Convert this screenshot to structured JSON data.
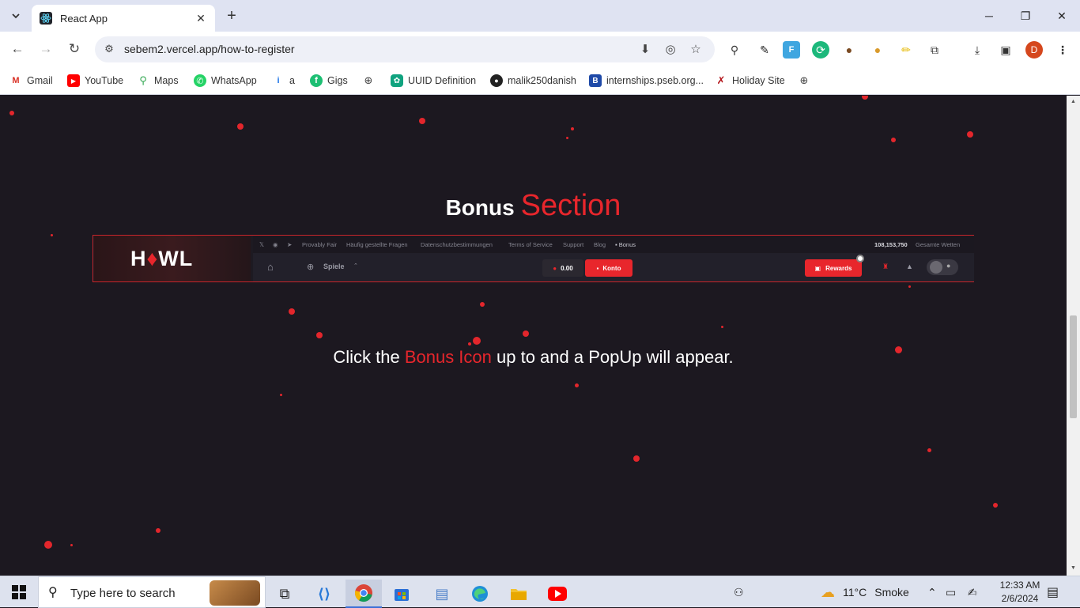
{
  "browser": {
    "tab_title": "React App",
    "url": "sebem2.vercel.app/how-to-register",
    "avatar_letter": "D",
    "bookmarks": [
      {
        "label": "Gmail",
        "icon": "gmail-icon"
      },
      {
        "label": "YouTube",
        "icon": "youtube-icon"
      },
      {
        "label": "Maps",
        "icon": "maps-icon"
      },
      {
        "label": "WhatsApp",
        "icon": "whatsapp-icon"
      },
      {
        "label": "a",
        "icon": "info-icon"
      },
      {
        "label": "Gigs",
        "icon": "fiverr-icon"
      },
      {
        "label": "",
        "icon": "globe-icon"
      },
      {
        "label": "UUID Definition",
        "icon": "openai-icon"
      },
      {
        "label": "malik250danish",
        "icon": "github-icon"
      },
      {
        "label": "internships.pseb.org...",
        "icon": "pseb-icon"
      },
      {
        "label": "Holiday Site",
        "icon": "holiday-icon"
      },
      {
        "label": "",
        "icon": "globe-icon"
      }
    ]
  },
  "page": {
    "heading_word1": "Bonus",
    "heading_word2": "Section",
    "banner": {
      "logo_left": "H",
      "logo_right": "WL",
      "top_links": [
        "Provably Fair",
        "Häufig gestellte Fragen",
        "Datenschutzbestimmungen",
        "Terms of Service",
        "Support",
        "Blog",
        "Bonus"
      ],
      "total_bets_value": "108,153,750",
      "total_bets_label": "Gesamte Wetten",
      "games_label": "Spiele",
      "balance": "0.00",
      "account_button": "Konto",
      "rewards_button": "Rewards"
    },
    "caption_pre": "Click the",
    "caption_highlight": "Bonus Icon",
    "caption_post": "up to and a PopUp will appear."
  },
  "taskbar": {
    "search_placeholder": "Type here to search",
    "weather_temp": "11°C",
    "weather_desc": "Smoke",
    "time": "12:33 AM",
    "date": "2/6/2024"
  },
  "colors": {
    "accent": "#e8262c",
    "page_bg": "#1c1820"
  }
}
